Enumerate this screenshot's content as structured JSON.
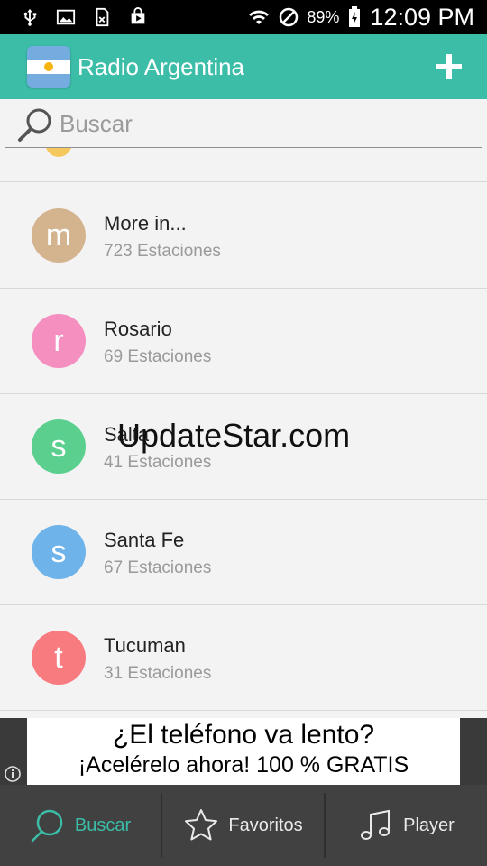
{
  "status_bar": {
    "battery_percent": "89%",
    "time": "12:09 PM",
    "icons": [
      "usb-icon",
      "image-icon",
      "sim-icon",
      "play-store-icon",
      "wifi-icon",
      "do-not-disturb-icon",
      "battery-charging-icon"
    ]
  },
  "app_bar": {
    "title": "Radio Argentina",
    "flag_icon": "argentina-flag-icon",
    "add_icon": "plus-icon",
    "color": "#3bbda8"
  },
  "search": {
    "placeholder": "Buscar",
    "value": ""
  },
  "list": {
    "items": [
      {
        "initial": "m",
        "title": "More in...",
        "subtitle": "723 Estaciones",
        "color": "#d3b48e"
      },
      {
        "initial": "r",
        "title": "Rosario",
        "subtitle": "69 Estaciones",
        "color": "#f48fbf"
      },
      {
        "initial": "s",
        "title": "Salta",
        "subtitle": "41 Estaciones",
        "color": "#5bd08e"
      },
      {
        "initial": "s",
        "title": "Santa Fe",
        "subtitle": "67 Estaciones",
        "color": "#6eb4ea"
      },
      {
        "initial": "t",
        "title": "Tucuman",
        "subtitle": "31 Estaciones",
        "color": "#f77b7f"
      }
    ]
  },
  "watermark": "UpdateStar.com",
  "ad": {
    "line1": "¿El teléfono va lento?",
    "line2": "¡Acelérelo ahora! 100 % GRATIS"
  },
  "bottom_nav": {
    "tabs": [
      {
        "label": "Buscar",
        "icon": "search-icon",
        "active": true
      },
      {
        "label": "Favoritos",
        "icon": "star-icon",
        "active": false
      },
      {
        "label": "Player",
        "icon": "music-note-icon",
        "active": false
      }
    ]
  }
}
